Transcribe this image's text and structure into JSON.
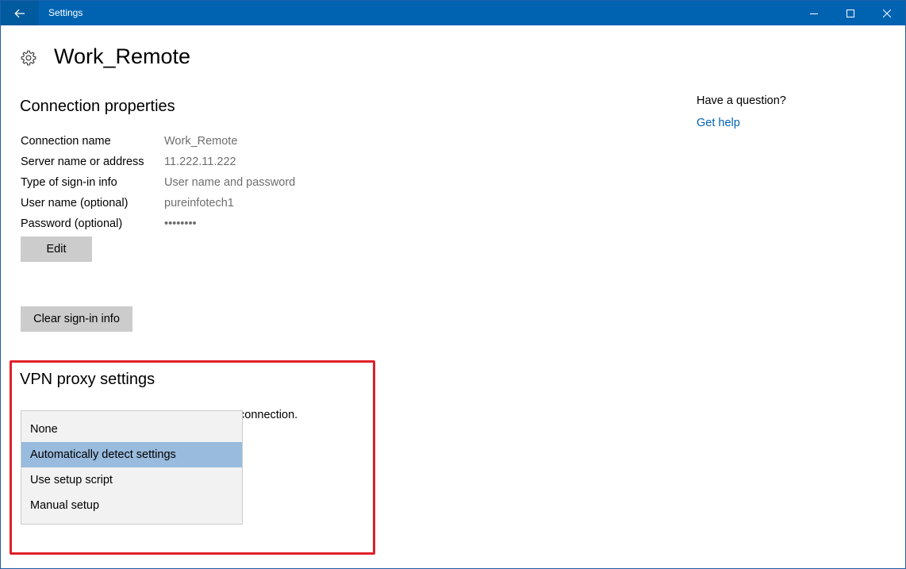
{
  "window": {
    "title": "Settings",
    "colors": {
      "titlebar": "#0063b1",
      "back_button": "#005a9e",
      "highlight": "#e0202a",
      "selected": "#99bbdd",
      "link": "#0063b1"
    }
  },
  "header": {
    "icon": "gear-icon",
    "title": "Work_Remote"
  },
  "connection": {
    "title": "Connection properties",
    "rows": [
      {
        "label": "Connection name",
        "value": "Work_Remote"
      },
      {
        "label": "Server name or address",
        "value": "11.222.11.222"
      },
      {
        "label": "Type of sign-in info",
        "value": "User name and password"
      },
      {
        "label": "User name (optional)",
        "value": "pureinfotech1"
      },
      {
        "label": "Password (optional)",
        "value": "••••••••"
      }
    ],
    "edit_label": "Edit",
    "clear_label": "Clear sign-in info"
  },
  "help": {
    "question": "Have a question?",
    "link": "Get help"
  },
  "proxy": {
    "title": "VPN proxy settings",
    "partial_text": "connection.",
    "options": [
      "None",
      "Automatically detect settings",
      "Use setup script",
      "Manual setup"
    ],
    "selected_option": "Automatically detect settings"
  }
}
